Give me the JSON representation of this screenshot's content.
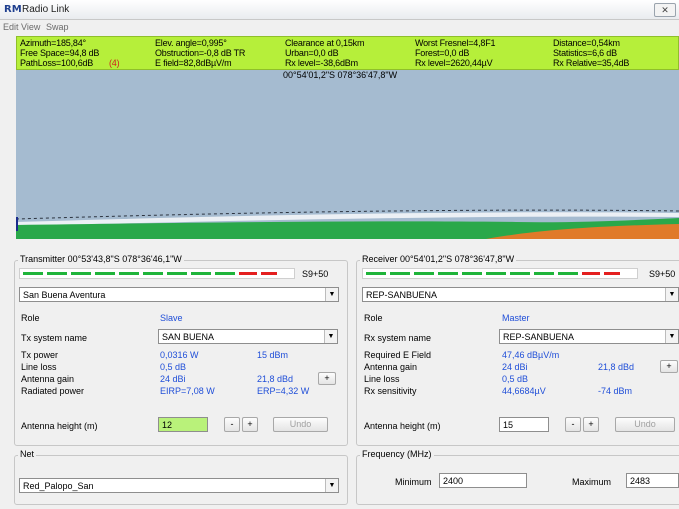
{
  "window": {
    "logo": "RM",
    "title": "Radio Link",
    "close_icon": "close-icon"
  },
  "menu": [
    "Edit",
    "View",
    "Swap"
  ],
  "info": {
    "col1": [
      "Azimuth=185,84°",
      "Free Space=94,8 dB",
      "PathLoss=100,6dB",
      "(4)"
    ],
    "col2": [
      "Elev. angle=0,995°",
      "Obstruction=-0,8 dB TR",
      "E field=82,8dBµV/m"
    ],
    "col3": [
      "Clearance at 0,15km",
      "Urban=0,0 dB",
      "Rx level=-38,6dBm"
    ],
    "col4": [
      "Worst Fresnel=4,8F1",
      "Forest=0,0 dB",
      "Rx level=2620,44µV"
    ],
    "col5": [
      "Distance=0,54km",
      "Statistics=6,6 dB",
      "Rx Relative=35,4dB"
    ]
  },
  "profile": {
    "coord": "00°54'01,2\"S 078°36'47,8\"W",
    "sky_color": "#a5bbd0",
    "terrain_colors": [
      "#2aa84a",
      "#e07a2a"
    ]
  },
  "transmitter": {
    "title": "Transmitter 00°53'43,8\"S 078°36'46,1\"W",
    "signal_label": "S9+50",
    "unit_name": "San Buena Aventura",
    "role_label": "Role",
    "role_value": "Slave",
    "system_label": "Tx system name",
    "system_value": "SAN BUENA",
    "power_label": "Tx power",
    "power_w": "0,0316 W",
    "power_dbm": "15 dBm",
    "loss_label": "Line loss",
    "loss_value": "0,5 dB",
    "gain_label": "Antenna gain",
    "gain_dbi": "24 dBi",
    "gain_dbd": "21,8 dBd",
    "radiated_label": "Radiated power",
    "eirp": "EIRP=7,08 W",
    "erp": "ERP=4,32 W",
    "height_label": "Antenna height (m)",
    "height_value": "12",
    "minus": "-",
    "plus": "+",
    "undo": "Undo"
  },
  "receiver": {
    "title": "Receiver 00°54'01,2\"S 078°36'47,8\"W",
    "signal_label": "S9+50",
    "unit_name": "REP-SANBUENA",
    "role_label": "Role",
    "role_value": "Master",
    "system_label": "Rx system name",
    "system_value": "REP-SANBUENA",
    "field_label": "Required E Field",
    "field_value": "47,46 dBµV/m",
    "gain_label": "Antenna gain",
    "gain_dbi": "24 dBi",
    "gain_dbd": "21,8 dBd",
    "loss_label": "Line loss",
    "loss_value": "0,5 dB",
    "sens_label": "Rx sensitivity",
    "sens_uv": "44,6684µV",
    "sens_dbm": "-74 dBm",
    "height_label": "Antenna height (m)",
    "height_value": "15",
    "minus": "-",
    "plus": "+",
    "undo": "Undo"
  },
  "net": {
    "title": "Net",
    "value": "Red_Palopo_San"
  },
  "frequency": {
    "title": "Frequency (MHz)",
    "min_label": "Minimum",
    "min_value": "2400",
    "max_label": "Maximum",
    "max_value": "2483"
  }
}
